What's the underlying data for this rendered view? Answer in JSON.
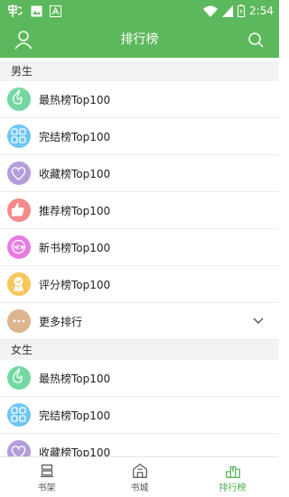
{
  "status": {
    "time": "2:54"
  },
  "header": {
    "title": "排行榜"
  },
  "sections": [
    {
      "title": "男生",
      "items": [
        {
          "label": "最热榜Top100",
          "color": "#74d8a2",
          "icon": "flame-icon"
        },
        {
          "label": "完结榜Top100",
          "color": "#6ec6f5",
          "icon": "grid-icon"
        },
        {
          "label": "收藏榜Top100",
          "color": "#b39ddb",
          "icon": "heart-icon"
        },
        {
          "label": "推荐榜Top100",
          "color": "#f48a8a",
          "icon": "thumbs-up-icon"
        },
        {
          "label": "新书榜Top100",
          "color": "#e77be0",
          "icon": "new-badge-icon"
        },
        {
          "label": "评分榜Top100",
          "color": "#f7c75c",
          "icon": "award-icon"
        },
        {
          "label": "更多排行",
          "color": "#dcb48f",
          "icon": "more-icon",
          "expandable": true
        }
      ]
    },
    {
      "title": "女生",
      "items": [
        {
          "label": "最热榜Top100",
          "color": "#74d8a2",
          "icon": "flame-icon"
        },
        {
          "label": "完结榜Top100",
          "color": "#6ec6f5",
          "icon": "grid-icon"
        },
        {
          "label": "收藏榜Top100",
          "color": "#b39ddb",
          "icon": "heart-icon"
        }
      ]
    }
  ],
  "tabs": [
    {
      "label": "书架",
      "icon": "bookshelf-icon",
      "active": false
    },
    {
      "label": "书城",
      "icon": "bookstore-icon",
      "active": false
    },
    {
      "label": "排行榜",
      "icon": "ranking-icon",
      "active": true
    }
  ],
  "colors": {
    "primary": "#5cb85c",
    "active_tab": "#4caf50"
  }
}
